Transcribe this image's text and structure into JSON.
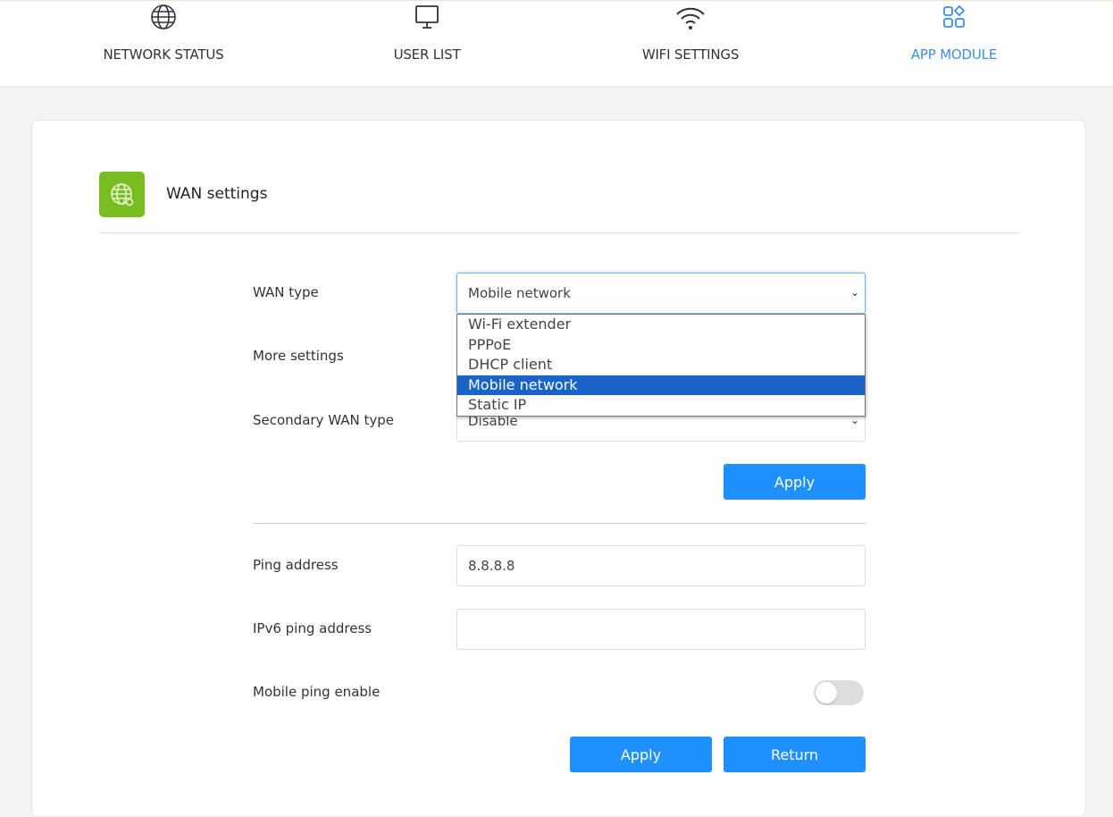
{
  "nav": {
    "items": [
      {
        "label": "NETWORK STATUS",
        "icon": "globe-icon"
      },
      {
        "label": "USER LIST",
        "icon": "monitor-icon"
      },
      {
        "label": "WIFI SETTINGS",
        "icon": "wifi-icon"
      },
      {
        "label": "APP MODULE",
        "icon": "apps-icon"
      }
    ],
    "active": "APP MODULE"
  },
  "section": {
    "title": "WAN settings",
    "icon": "globe-settings-icon"
  },
  "form": {
    "wan_type_label": "WAN type",
    "wan_type_value": "Mobile network",
    "more_settings_label": "More settings",
    "secondary_label": "Secondary WAN type",
    "secondary_value": "Disable",
    "apply1": "Apply",
    "ping_label": "Ping address",
    "ping_value": "8.8.8.8",
    "ipv6_label": "IPv6 ping address",
    "ipv6_value": "",
    "mobile_ping_label": "Mobile ping enable",
    "mobile_ping_enabled": false,
    "apply2": "Apply",
    "return": "Return"
  },
  "dropdown": {
    "options": [
      "Wi-Fi extender",
      "PPPoE",
      "DHCP client",
      "Mobile network",
      "Static IP"
    ],
    "selected": "Mobile network"
  },
  "colors": {
    "accent": "#1e90ff",
    "active_nav": "#3a8ee6",
    "section_icon": "#78bd1f",
    "highlight": "#1a64c8"
  }
}
